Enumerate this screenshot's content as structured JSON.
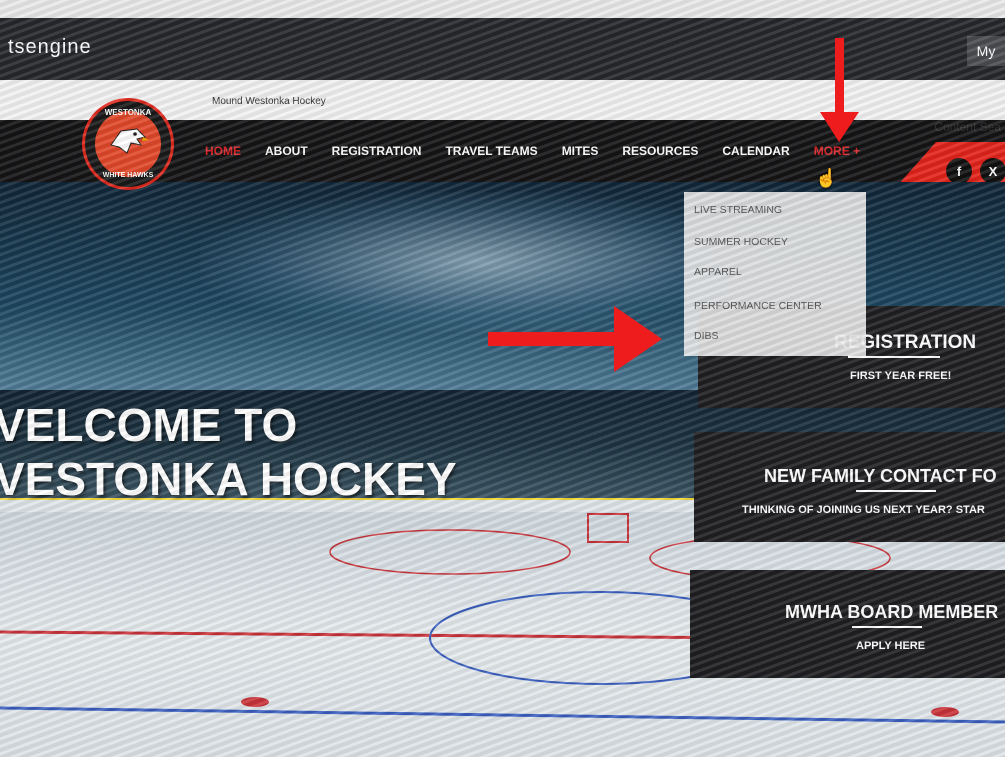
{
  "topbar": {
    "brand": "tsengine",
    "account_label": "My",
    "site_name": "Mound Westonka Hockey",
    "content_search": "Content Sea"
  },
  "logo": {
    "top_text": "WESTONKA",
    "bottom_text": "WHITE HAWKS"
  },
  "nav": {
    "items": [
      {
        "label": "HOME"
      },
      {
        "label": "ABOUT"
      },
      {
        "label": "REGISTRATION"
      },
      {
        "label": "TRAVEL TEAMS"
      },
      {
        "label": "MITES"
      },
      {
        "label": "RESOURCES"
      },
      {
        "label": "CALENDAR"
      },
      {
        "label": "MORE +"
      }
    ]
  },
  "social": {
    "facebook": "f",
    "x": "X"
  },
  "dropdown": {
    "items": [
      {
        "label": "LIVE STREAMING"
      },
      {
        "label": "SUMMER HOCKEY"
      },
      {
        "label": "APPAREL"
      },
      {
        "label": "PERFORMANCE CENTER"
      },
      {
        "label": "DIBS"
      }
    ]
  },
  "hero": {
    "line1": "VELCOME TO",
    "line2": "VESTONKA HOCKEY"
  },
  "cards": [
    {
      "title": "REGISTRATION",
      "subtitle": "FIRST YEAR FREE!"
    },
    {
      "title": "NEW FAMILY CONTACT FO",
      "subtitle": "THINKING OF JOINING US NEXT YEAR? STAR"
    },
    {
      "title": "MWHA BOARD MEMBER",
      "subtitle": "APPLY HERE"
    }
  ],
  "colors": {
    "accent": "#e2231a",
    "nav_bg": "#141416",
    "card_bg": "#1f1f22"
  }
}
